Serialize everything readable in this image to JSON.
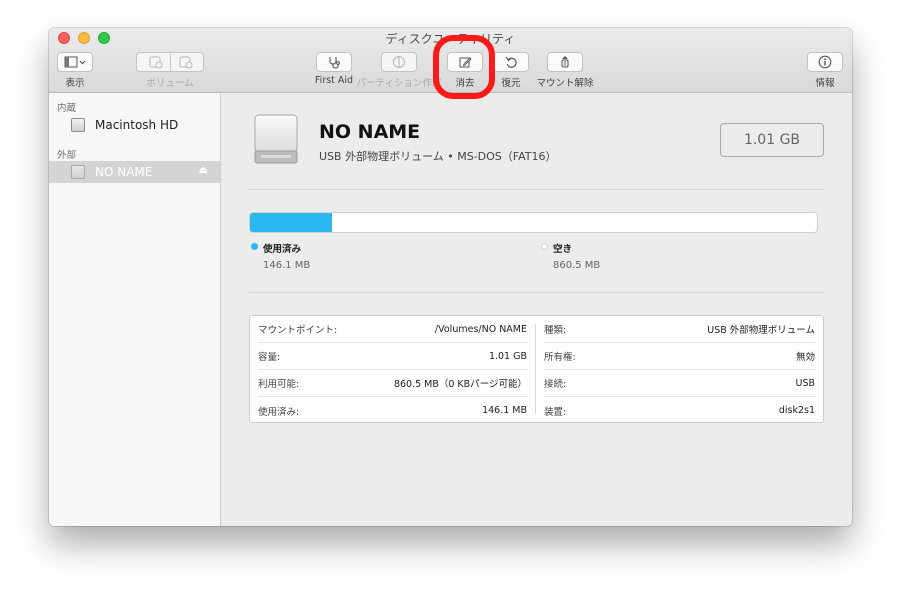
{
  "window": {
    "title": "ディスクユーティリティ"
  },
  "toolbar": {
    "view_label": "表示",
    "volume_label": "ボリューム",
    "first_aid_label": "First Aid",
    "partition_label": "パーティション作成",
    "erase_label": "消去",
    "restore_label": "復元",
    "unmount_label": "マウント解除",
    "info_label": "情報"
  },
  "sidebar": {
    "internal_header": "内蔵",
    "internal_items": [
      {
        "label": "Macintosh HD"
      }
    ],
    "external_header": "外部",
    "external_items": [
      {
        "label": "NO NAME",
        "selected": true
      }
    ]
  },
  "volume": {
    "name": "NO NAME",
    "subtitle": "USB 外部物理ボリューム • MS-DOS（FAT16）",
    "capacity": "1.01 GB"
  },
  "usage": {
    "used_fraction": 0.145,
    "used_label": "使用済み",
    "used_value": "146.1 MB",
    "free_label": "空き",
    "free_value": "860.5 MB",
    "used_color": "#2bb7f2",
    "free_color": "#ffffff"
  },
  "info": {
    "left": [
      {
        "key": "マウントポイント:",
        "value": "/Volumes/NO NAME"
      },
      {
        "key": "容量:",
        "value": "1.01 GB"
      },
      {
        "key": "利用可能:",
        "value": "860.5 MB（0 KBパージ可能）"
      },
      {
        "key": "使用済み:",
        "value": "146.1 MB"
      }
    ],
    "right": [
      {
        "key": "種類:",
        "value": "USB 外部物理ボリューム"
      },
      {
        "key": "所有権:",
        "value": "無効"
      },
      {
        "key": "接続:",
        "value": "USB"
      },
      {
        "key": "装置:",
        "value": "disk2s1"
      }
    ]
  },
  "colors": {
    "highlight": "#ff1a1a",
    "accent": "#2bb7f2"
  }
}
